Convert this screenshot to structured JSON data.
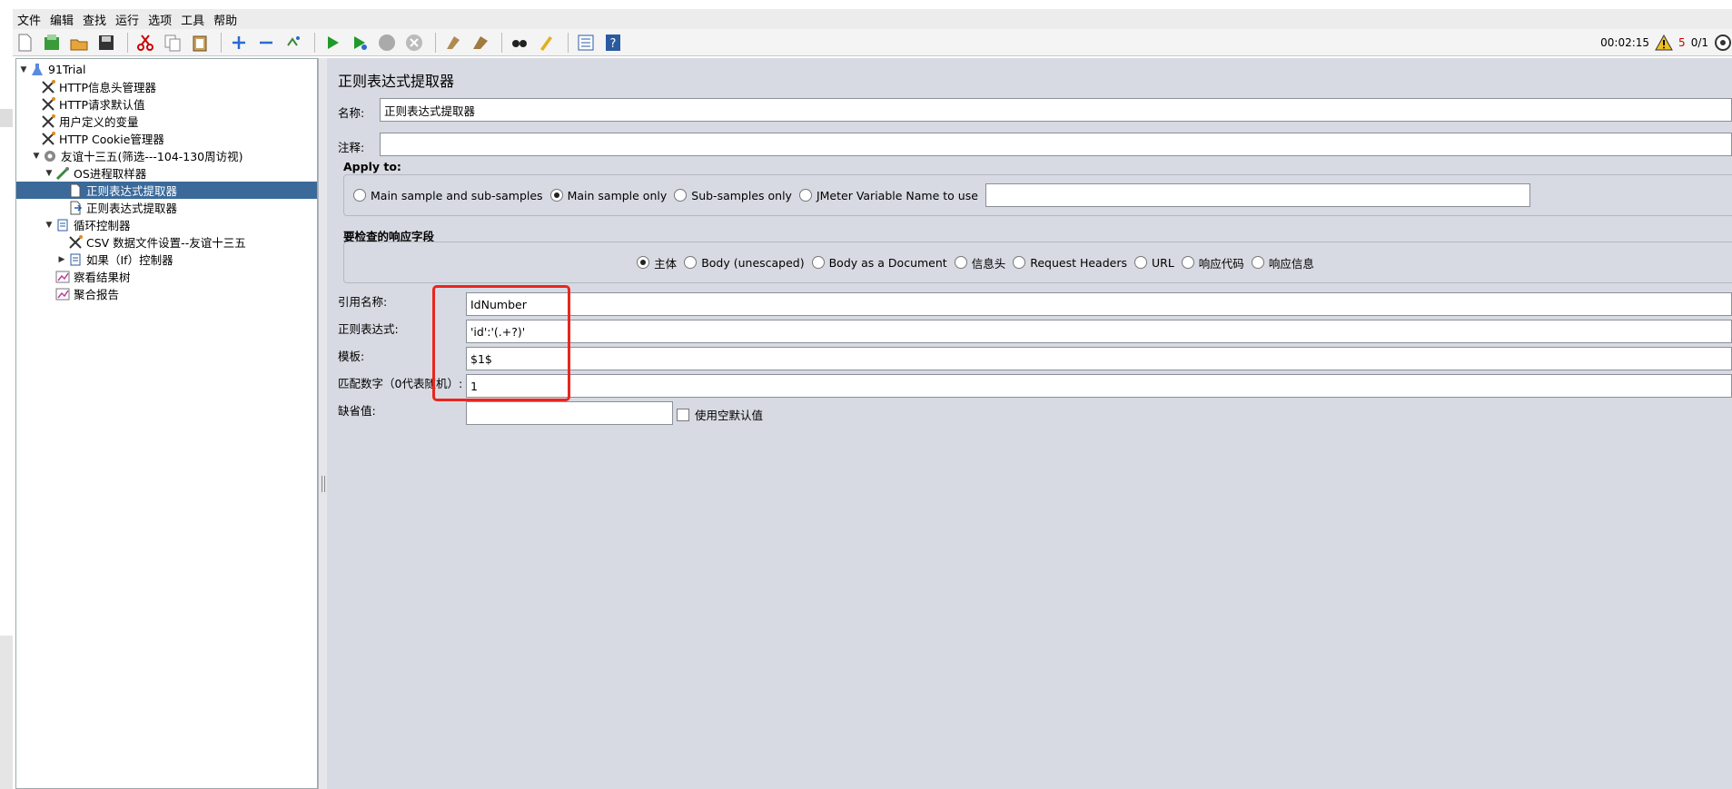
{
  "menu": [
    "文件",
    "编辑",
    "查找",
    "运行",
    "选项",
    "工具",
    "帮助"
  ],
  "status": {
    "time": "00:02:15",
    "warnings": "5",
    "threads": "0/1"
  },
  "tree": [
    {
      "label": "91Trial"
    },
    {
      "label": "HTTP信息头管理器"
    },
    {
      "label": "HTTP请求默认值"
    },
    {
      "label": "用户定义的变量"
    },
    {
      "label": "HTTP Cookie管理器"
    },
    {
      "label": "友谊十三五(筛选---104-130周访视)"
    },
    {
      "label": "OS进程取样器"
    },
    {
      "label": "正则表达式提取器"
    },
    {
      "label": "正则表达式提取器"
    },
    {
      "label": "循环控制器"
    },
    {
      "label": "CSV 数据文件设置--友谊十三五"
    },
    {
      "label": "如果（If）控制器"
    },
    {
      "label": "察看结果树"
    },
    {
      "label": "聚合报告"
    }
  ],
  "panel": {
    "title": "正则表达式提取器",
    "name_label": "名称:",
    "name_value": "正则表达式提取器",
    "comment_label": "注释:",
    "apply_title": "Apply to:",
    "apply_options": [
      "Main sample and sub-samples",
      "Main sample only",
      "Sub-samples only",
      "JMeter Variable Name to use"
    ],
    "field_title": "要检查的响应字段",
    "field_options": [
      "主体",
      "Body (unescaped)",
      "Body as a Document",
      "信息头",
      "Request Headers",
      "URL",
      "响应代码",
      "响应信息"
    ],
    "ref_label": "引用名称:",
    "ref_value": "IdNumber",
    "regex_label": "正则表达式:",
    "regex_value": "'id':'(.+?)'",
    "template_label": "模板:",
    "template_value": "$1$",
    "match_label": "匹配数字（0代表随机）:",
    "match_value": "1",
    "default_label": "缺省值:",
    "default_value": "",
    "empty_default_label": "使用空默认值"
  },
  "colors": {
    "selection": "#3b6a9a",
    "highlight": "#e8261e",
    "panel_bg": "#d7dae2"
  }
}
